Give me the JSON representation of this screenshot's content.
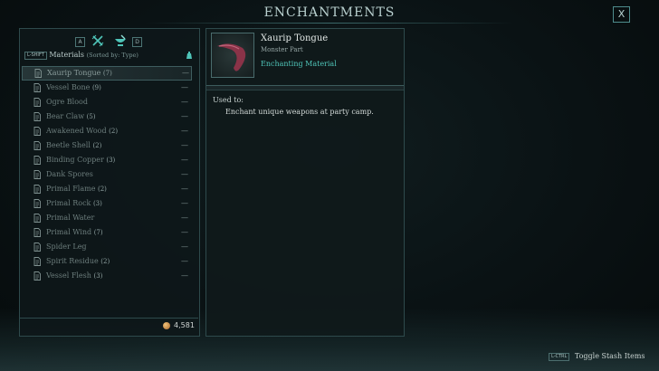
{
  "header": {
    "title": "ENCHANTMENTS",
    "close_label": "X"
  },
  "filters": {
    "prev_key": "A",
    "next_key": "D"
  },
  "materials_header": {
    "shift_tag": "L-SHIFT",
    "label": "Materials",
    "sort_note": "(Sorted by: Type)"
  },
  "materials": [
    {
      "name": "Xaurip Tongue",
      "count": "(7)",
      "selected": true
    },
    {
      "name": "Vessel Bone",
      "count": "(9)"
    },
    {
      "name": "Ogre Blood",
      "count": ""
    },
    {
      "name": "Bear Claw",
      "count": "(5)"
    },
    {
      "name": "Awakened Wood",
      "count": "(2)"
    },
    {
      "name": "Beetle Shell",
      "count": "(2)"
    },
    {
      "name": "Binding Copper",
      "count": "(3)"
    },
    {
      "name": "Dank Spores",
      "count": ""
    },
    {
      "name": "Primal Flame",
      "count": "(2)"
    },
    {
      "name": "Primal Rock",
      "count": "(3)"
    },
    {
      "name": "Primal Water",
      "count": ""
    },
    {
      "name": "Primal Wind",
      "count": "(7)"
    },
    {
      "name": "Spider Leg",
      "count": ""
    },
    {
      "name": "Spirit Residue",
      "count": "(2)"
    },
    {
      "name": "Vessel Flesh",
      "count": "(3)"
    }
  ],
  "row_dash": "—",
  "gold": {
    "amount": "4,581"
  },
  "detail": {
    "name": "Xaurip Tongue",
    "type": "Monster Part",
    "category": "Enchanting Material",
    "used_label": "Used to:",
    "used_text": "Enchant unique weapons at party camp."
  },
  "footer": {
    "key": "L-CTRL",
    "label": "Toggle Stash Items"
  },
  "colors": {
    "accent": "#4fc4b8",
    "panel_border": "#2e4a4c"
  }
}
